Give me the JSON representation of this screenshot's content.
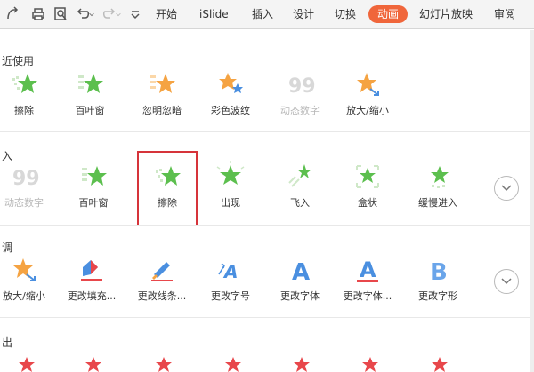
{
  "toolbar": {
    "icons": [
      "revision-icon",
      "print-icon",
      "print-preview-icon",
      "undo-icon",
      "undo-dropdown-icon",
      "redo-icon",
      "redo-dropdown-icon",
      "more-icon"
    ],
    "tabs": [
      "开始",
      "iSlide",
      "插入",
      "设计",
      "切换",
      "动画",
      "幻灯片放映",
      "审阅"
    ],
    "active_tab": "动画"
  },
  "colors": {
    "accent": "#f0663b",
    "green_star": "#5cbf4e",
    "orange_star": "#f5a342",
    "red_star": "#e8474b",
    "blue": "#4a8fe0",
    "selection": "#d6343a"
  },
  "sections": {
    "recent": {
      "title": "近使用",
      "items": [
        {
          "label": "擦除",
          "icon": "wipe-icon"
        },
        {
          "label": "百叶窗",
          "icon": "blinds-icon"
        },
        {
          "label": "忽明忽暗",
          "icon": "flicker-icon"
        },
        {
          "label": "彩色波纹",
          "icon": "color-wave-icon"
        },
        {
          "label": "动态数字",
          "icon": "dynamic-number-icon"
        },
        {
          "label": "放大/缩小",
          "icon": "grow-shrink-icon"
        }
      ]
    },
    "entrance": {
      "title": "入",
      "items": [
        {
          "label": "动态数字",
          "icon": "dynamic-number-icon"
        },
        {
          "label": "百叶窗",
          "icon": "blinds-icon"
        },
        {
          "label": "擦除",
          "icon": "wipe-icon"
        },
        {
          "label": "出现",
          "icon": "appear-icon"
        },
        {
          "label": "飞入",
          "icon": "fly-in-icon"
        },
        {
          "label": "盒状",
          "icon": "box-icon"
        },
        {
          "label": "缓慢进入",
          "icon": "crawl-in-icon"
        }
      ],
      "selected_label": "擦除"
    },
    "emphasis": {
      "title": "调",
      "items": [
        {
          "label": "放大/缩小",
          "icon": "grow-shrink-icon"
        },
        {
          "label": "更改填充...",
          "icon": "change-fill-icon"
        },
        {
          "label": "更改线条...",
          "icon": "change-line-icon"
        },
        {
          "label": "更改字号",
          "icon": "change-font-size-icon"
        },
        {
          "label": "更改字体",
          "icon": "change-font-icon"
        },
        {
          "label": "更改字体...",
          "icon": "change-font-color-icon"
        },
        {
          "label": "更改字形",
          "icon": "change-font-style-icon"
        }
      ]
    },
    "exit": {
      "title": "出"
    }
  }
}
